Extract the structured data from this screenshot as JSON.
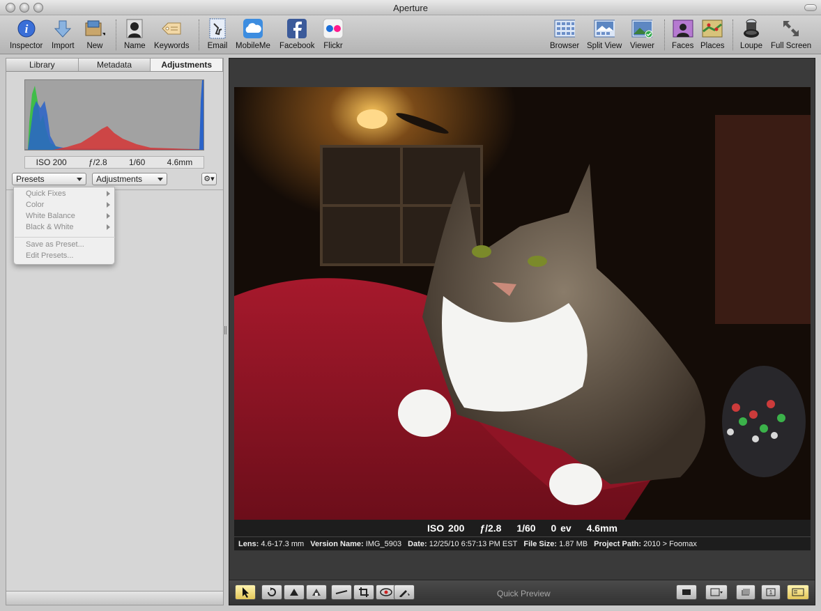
{
  "window": {
    "title": "Aperture"
  },
  "toolbar": {
    "items": [
      {
        "id": "inspector",
        "label": "Inspector",
        "icon": "info-icon"
      },
      {
        "id": "import",
        "label": "Import",
        "icon": "import-arrow-icon"
      },
      {
        "id": "new",
        "label": "New",
        "icon": "new-project-icon"
      },
      {
        "id": "name",
        "label": "Name",
        "icon": "person-silhouette-icon"
      },
      {
        "id": "keywords",
        "label": "Keywords",
        "icon": "tag-icon"
      },
      {
        "id": "email",
        "label": "Email",
        "icon": "stamp-icon"
      },
      {
        "id": "mobileme",
        "label": "MobileMe",
        "icon": "cloud-icon"
      },
      {
        "id": "facebook",
        "label": "Facebook",
        "icon": "facebook-icon"
      },
      {
        "id": "flickr",
        "label": "Flickr",
        "icon": "flickr-icon"
      },
      {
        "id": "browser",
        "label": "Browser",
        "icon": "grid-icon"
      },
      {
        "id": "split_view",
        "label": "Split View",
        "icon": "split-view-icon"
      },
      {
        "id": "viewer",
        "label": "Viewer",
        "icon": "viewer-icon"
      },
      {
        "id": "faces",
        "label": "Faces",
        "icon": "faces-icon"
      },
      {
        "id": "places",
        "label": "Places",
        "icon": "map-icon"
      },
      {
        "id": "loupe",
        "label": "Loupe",
        "icon": "loupe-icon"
      },
      {
        "id": "full_screen",
        "label": "Full Screen",
        "icon": "expand-arrows-icon"
      }
    ]
  },
  "inspector": {
    "tabs": [
      {
        "label": "Library",
        "active": false
      },
      {
        "label": "Metadata",
        "active": false
      },
      {
        "label": "Adjustments",
        "active": true
      }
    ],
    "histogram_info": {
      "iso": "ISO 200",
      "aperture": "ƒ/2.8",
      "shutter": "1/60",
      "focal": "4.6mm"
    },
    "presets_label": "Presets",
    "adjustments_label": "Adjustments",
    "presets_menu": {
      "items": [
        {
          "label": "Quick Fixes",
          "submenu": true
        },
        {
          "label": "Color",
          "submenu": true
        },
        {
          "label": "White Balance",
          "submenu": true
        },
        {
          "label": "Black & White",
          "submenu": true
        }
      ],
      "actions": [
        {
          "label": "Save as Preset..."
        },
        {
          "label": "Edit Presets..."
        }
      ]
    }
  },
  "viewer": {
    "overlay": {
      "iso": "ISO 200",
      "aperture": "ƒ/2.8",
      "shutter": "1/60",
      "ev": "0 ev",
      "focal": "4.6mm"
    },
    "details": [
      {
        "key": "Lens:",
        "value": "4.6-17.3 mm"
      },
      {
        "key": "Version Name:",
        "value": "IMG_5903"
      },
      {
        "key": "Date:",
        "value": "12/25/10 6:57:13 PM EST"
      },
      {
        "key": "File Size:",
        "value": "1.87 MB"
      },
      {
        "key": "Project Path:",
        "value": "2010 > Foomax"
      }
    ],
    "status": "Quick Preview"
  },
  "colors": {
    "accent_active_tool": "#e3c659",
    "viewer_bg": "#3a3a3a",
    "panel_bg": "#d6d6d6"
  }
}
